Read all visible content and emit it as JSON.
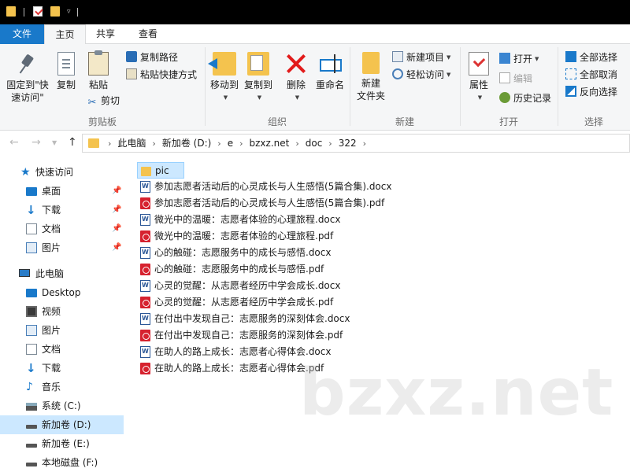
{
  "title_bar": {
    "quick_access_icons": [
      "folder-icon",
      "properties-icon",
      "new-folder-icon",
      "customize-dropdown-icon"
    ]
  },
  "tabs": {
    "file": "文件",
    "home": "主页",
    "share": "共享",
    "view": "查看"
  },
  "ribbon": {
    "clipboard": {
      "pin_quick_access_line1": "固定到\"快",
      "pin_quick_access_line2": "速访问\"",
      "copy": "复制",
      "paste": "粘贴",
      "copy_path": "复制路径",
      "paste_shortcut": "粘贴快捷方式",
      "cut": "剪切",
      "group_label": "剪贴板"
    },
    "organize": {
      "move_to": "移动到",
      "copy_to": "复制到",
      "delete": "删除",
      "rename": "重命名",
      "group_label": "组织"
    },
    "new": {
      "new_folder_line1": "新建",
      "new_folder_line2": "文件夹",
      "new_item": "新建项目",
      "easy_access": "轻松访问",
      "group_label": "新建"
    },
    "open": {
      "properties": "属性",
      "open": "打开",
      "edit": "编辑",
      "history": "历史记录",
      "group_label": "打开"
    },
    "select": {
      "select_all": "全部选择",
      "select_none": "全部取消",
      "invert_selection": "反向选择",
      "group_label": "选择"
    }
  },
  "address": {
    "crumbs": [
      "此电脑",
      "新加卷 (D:)",
      "e",
      "bzxz.net",
      "doc",
      "322"
    ]
  },
  "nav": {
    "quick_access": "快速访问",
    "desktop_pinned": "桌面",
    "downloads_pinned": "下载",
    "documents_pinned": "文档",
    "pictures_pinned": "图片",
    "this_pc": "此电脑",
    "desktop": "Desktop",
    "videos": "视频",
    "pictures": "图片",
    "documents": "文档",
    "downloads": "下载",
    "music": "音乐",
    "drive_c": "系统 (C:)",
    "drive_d": "新加卷 (D:)",
    "drive_e": "新加卷 (E:)",
    "drive_f": "本地磁盘 (F:)"
  },
  "files": [
    {
      "name": "pic",
      "type": "folder"
    },
    {
      "name": "参加志愿者活动后的心灵成长与人生感悟(5篇合集).docx",
      "type": "docx"
    },
    {
      "name": "参加志愿者活动后的心灵成长与人生感悟(5篇合集).pdf",
      "type": "pdf"
    },
    {
      "name": "微光中的温暖：志愿者体验的心理旅程.docx",
      "type": "docx"
    },
    {
      "name": "微光中的温暖：志愿者体验的心理旅程.pdf",
      "type": "pdf"
    },
    {
      "name": "心的触碰：志愿服务中的成长与感悟.docx",
      "type": "docx"
    },
    {
      "name": "心的触碰：志愿服务中的成长与感悟.pdf",
      "type": "pdf"
    },
    {
      "name": "心灵的觉醒：从志愿者经历中学会成长.docx",
      "type": "docx"
    },
    {
      "name": "心灵的觉醒：从志愿者经历中学会成长.pdf",
      "type": "pdf"
    },
    {
      "name": "在付出中发现自己：志愿服务的深刻体会.docx",
      "type": "docx"
    },
    {
      "name": "在付出中发现自己：志愿服务的深刻体会.pdf",
      "type": "pdf"
    },
    {
      "name": "在助人的路上成长：志愿者心得体会.docx",
      "type": "docx"
    },
    {
      "name": "在助人的路上成长：志愿者心得体会.pdf",
      "type": "pdf"
    }
  ],
  "watermark": "bzxz.net",
  "colors": {
    "accent": "#1979ca",
    "selection": "#cce8ff",
    "folder": "#f4c34e",
    "pdf": "#d6222f",
    "word": "#2b5797"
  }
}
